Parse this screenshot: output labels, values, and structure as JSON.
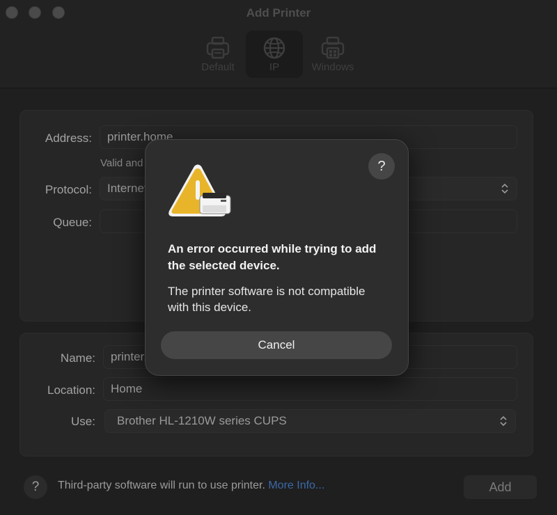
{
  "window": {
    "title": "Add Printer"
  },
  "toolbar": {
    "tabs": [
      {
        "label": "Default",
        "icon": "printer-icon"
      },
      {
        "label": "IP",
        "icon": "globe-icon"
      },
      {
        "label": "Windows",
        "icon": "windows-printer-icon"
      }
    ],
    "selected": "IP"
  },
  "form": {
    "address_label": "Address:",
    "address_value": "printer.home",
    "address_helper": "Valid and complete host name or address.",
    "protocol_label": "Protocol:",
    "protocol_value": "Internet Printing Protocol - IPP",
    "queue_label": "Queue:",
    "queue_value": "",
    "name_label": "Name:",
    "name_value": "printer.home",
    "location_label": "Location:",
    "location_value": "Home",
    "use_label": "Use:",
    "use_value": "Brother HL-1210W series CUPS"
  },
  "footer": {
    "help_label": "?",
    "notice": "Third-party software will run to use printer.",
    "more_info_link": "More Info...",
    "add_label": "Add"
  },
  "dialog": {
    "help_label": "?",
    "icon": "warning-printer-icon",
    "title": "An error occurred while trying to add the selected device.",
    "message": "The printer software is not compatible with this device.",
    "cancel_label": "Cancel"
  },
  "colors": {
    "accent_link": "#3b69a8",
    "warning_yellow": "#e8b52a"
  }
}
